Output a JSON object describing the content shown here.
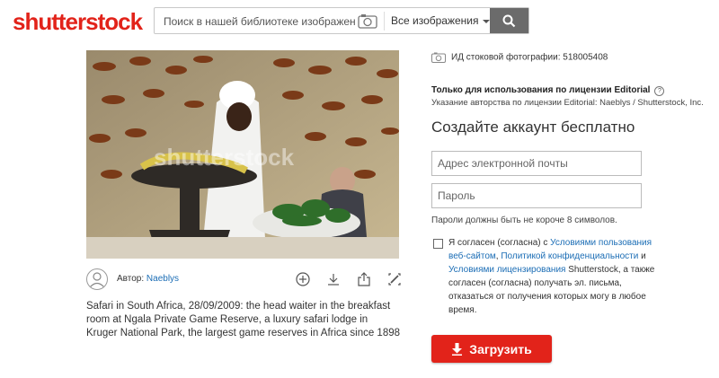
{
  "header": {
    "logo_text": "shutterstock",
    "search_placeholder": "Поиск в нашей библиотеке изображени",
    "image_type": "Все изображения"
  },
  "photo": {
    "watermark": "shutterstock"
  },
  "author": {
    "label": "Автор:",
    "name": "Naeblys"
  },
  "caption": "Safari in South Africa, 28/09/2009: the head waiter in the breakfast room at Ngala Private Game Reserve, a luxury safari lodge in Kruger National Park, the largest game reserves in Africa since 1898",
  "sidebar": {
    "stock_id": "ИД стоковой фотографии: 518005408",
    "editorial_title": "Только для использования по лицензии Editorial",
    "credit": "Указание авторства по лицензии Editorial: Naeblys / Shutterstock, Inc.",
    "signup_title": "Создайте аккаунт бесплатно",
    "email_placeholder": "Адрес электронной почты",
    "password_placeholder": "Пароль",
    "password_hint": "Пароли должны быть не короче 8 символов.",
    "agree_1": "Я согласен (согласна) с ",
    "agree_link_1": "Условиями пользования веб-сайтом",
    "agree_2": ", ",
    "agree_link_2": "Политикой конфиденциальности",
    "agree_3": " и ",
    "agree_link_3": "Условиями лицензирования",
    "agree_4": " Shutterstock, а также согласен (согласна) получать эл. письма, отказаться от получения которых могу в любое время.",
    "upload_label": "Загрузить"
  },
  "colors": {
    "brand_red": "#e2231a",
    "link_blue": "#1b6db5"
  }
}
